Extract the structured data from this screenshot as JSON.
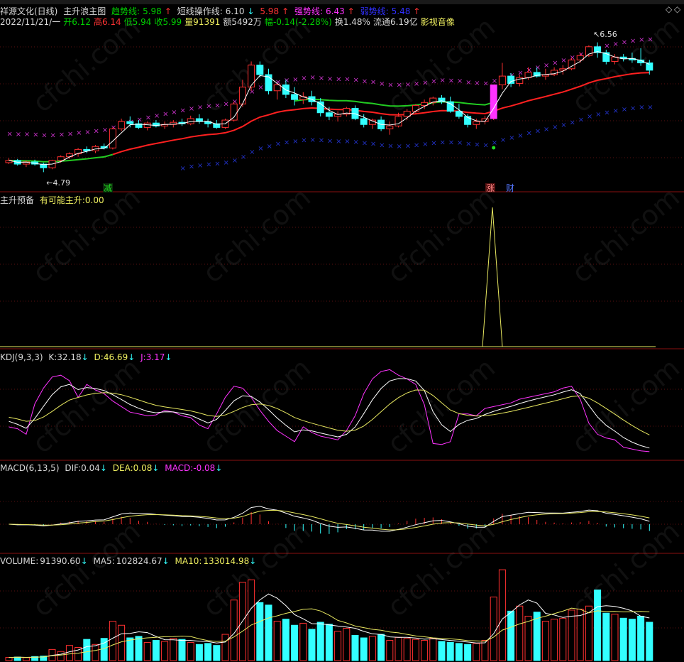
{
  "header": {
    "stock_name": "祥源文化(日线)",
    "indicator_name": "主升浪主图",
    "trend_label": "趋势线:",
    "trend_value": "5.98",
    "short_label": "短线操作线:",
    "short_value": "6.10",
    "mid_value": "5.98",
    "strong_label": "强势线:",
    "strong_value": "6.43",
    "weak_label": "弱势线:",
    "weak_value": "5.48",
    "date": "2022/11/21/一",
    "open_label": "开",
    "open": "6.12",
    "high_label": "高",
    "high": "6.14",
    "low_label": "低",
    "low": "5.94",
    "close_label": "收",
    "close": "5.99",
    "vol_label": "量",
    "vol": "91391",
    "amount_label": "额",
    "amount": "5492万",
    "chg_label": "幅",
    "chg": "-0.14(-2.28%)",
    "turnover_label": "换",
    "turnover": "1.48%",
    "float_label": "流通",
    "float": "6.19亿",
    "sector": "影视音像"
  },
  "panels": {
    "zsyb": {
      "title": "主升预备",
      "label": "有可能主升:",
      "value": "0.00"
    },
    "kdj": {
      "title": "KDJ(9,3,3)",
      "k_label": "K:",
      "k": "32.18",
      "d_label": "D:",
      "d": "46.69",
      "j_label": "J:",
      "j": "3.17"
    },
    "macd": {
      "title": "MACD(6,13,5)",
      "dif_label": "DIF:",
      "dif": "0.04",
      "dea_label": "DEA:",
      "dea": "0.08",
      "macd_label": "MACD:",
      "macd": "-0.08"
    },
    "vol": {
      "title": "VOLUME:",
      "volume": "91390.60",
      "ma5_label": "MA5:",
      "ma5": "102824.67",
      "ma10_label": "MA10:",
      "ma10": "133014.98"
    }
  },
  "annotations": {
    "low_mark": "4.79",
    "high_mark": "6.56",
    "jian": "减",
    "zhang": "涨",
    "cai": "财"
  },
  "watermark": "cfchi.com",
  "arrow_down": "↓",
  "arrow_up": "↑",
  "colors": {
    "up": "#ff3030",
    "down": "#33ffff",
    "trend": "#ff2020",
    "short": "#ffffff",
    "mid_green": "#22cc22",
    "strong": "#cc33cc",
    "weak": "#2233cc",
    "signal": "#ff33ff",
    "yellow": "#e8e860"
  },
  "chart_data": {
    "type": "candlestick",
    "ylim": [
      4.6,
      6.75
    ],
    "candles": [
      [
        4.92,
        4.98,
        4.9,
        4.95
      ],
      [
        4.95,
        4.97,
        4.88,
        4.9
      ],
      [
        4.9,
        4.95,
        4.86,
        4.93
      ],
      [
        4.93,
        4.96,
        4.88,
        4.9
      ],
      [
        4.9,
        4.92,
        4.79,
        4.85
      ],
      [
        4.85,
        4.96,
        4.83,
        4.95
      ],
      [
        4.95,
        5.02,
        4.92,
        5.0
      ],
      [
        5.0,
        5.06,
        4.97,
        5.04
      ],
      [
        5.04,
        5.12,
        5.0,
        5.1
      ],
      [
        5.1,
        5.14,
        5.05,
        5.08
      ],
      [
        5.08,
        5.16,
        5.05,
        5.14
      ],
      [
        5.14,
        5.18,
        5.1,
        5.12
      ],
      [
        5.12,
        5.4,
        5.1,
        5.38
      ],
      [
        5.38,
        5.52,
        5.35,
        5.48
      ],
      [
        5.48,
        5.55,
        5.4,
        5.45
      ],
      [
        5.45,
        5.5,
        5.38,
        5.4
      ],
      [
        5.4,
        5.48,
        5.36,
        5.46
      ],
      [
        5.46,
        5.5,
        5.4,
        5.42
      ],
      [
        5.42,
        5.48,
        5.38,
        5.44
      ],
      [
        5.44,
        5.5,
        5.4,
        5.47
      ],
      [
        5.47,
        5.52,
        5.42,
        5.45
      ],
      [
        5.45,
        5.56,
        5.43,
        5.52
      ],
      [
        5.52,
        5.58,
        5.45,
        5.48
      ],
      [
        5.48,
        5.52,
        5.4,
        5.45
      ],
      [
        5.45,
        5.5,
        5.38,
        5.4
      ],
      [
        5.4,
        5.52,
        5.38,
        5.5
      ],
      [
        5.5,
        5.75,
        5.48,
        5.72
      ],
      [
        5.72,
        6.05,
        5.68,
        5.95
      ],
      [
        5.95,
        6.3,
        5.9,
        6.25
      ],
      [
        6.25,
        6.3,
        6.08,
        6.12
      ],
      [
        6.12,
        6.2,
        5.85,
        5.9
      ],
      [
        5.9,
        6.0,
        5.78,
        5.98
      ],
      [
        5.98,
        6.05,
        5.8,
        5.85
      ],
      [
        5.85,
        5.95,
        5.7,
        5.78
      ],
      [
        5.78,
        5.88,
        5.72,
        5.82
      ],
      [
        5.82,
        5.9,
        5.7,
        5.75
      ],
      [
        5.75,
        5.8,
        5.55,
        5.6
      ],
      [
        5.6,
        5.68,
        5.5,
        5.55
      ],
      [
        5.55,
        5.62,
        5.48,
        5.58
      ],
      [
        5.58,
        5.68,
        5.55,
        5.66
      ],
      [
        5.66,
        5.7,
        5.5,
        5.52
      ],
      [
        5.52,
        5.58,
        5.4,
        5.44
      ],
      [
        5.44,
        5.52,
        5.38,
        5.5
      ],
      [
        5.5,
        5.55,
        5.35,
        5.38
      ],
      [
        5.38,
        5.48,
        5.3,
        5.42
      ],
      [
        5.42,
        5.6,
        5.4,
        5.55
      ],
      [
        5.55,
        5.65,
        5.5,
        5.62
      ],
      [
        5.62,
        5.72,
        5.58,
        5.7
      ],
      [
        5.7,
        5.78,
        5.65,
        5.74
      ],
      [
        5.74,
        5.82,
        5.7,
        5.8
      ],
      [
        5.8,
        5.84,
        5.72,
        5.75
      ],
      [
        5.75,
        5.82,
        5.6,
        5.62
      ],
      [
        5.62,
        5.72,
        5.52,
        5.55
      ],
      [
        5.55,
        5.58,
        5.4,
        5.44
      ],
      [
        5.44,
        5.52,
        5.38,
        5.48
      ],
      [
        5.48,
        5.56,
        5.44,
        5.52
      ],
      [
        5.52,
        5.98,
        5.5,
        5.98
      ],
      [
        5.98,
        6.28,
        5.92,
        6.1
      ],
      [
        6.1,
        6.14,
        5.95,
        6.0
      ],
      [
        6.0,
        6.12,
        5.96,
        6.08
      ],
      [
        6.08,
        6.22,
        6.05,
        6.15
      ],
      [
        6.15,
        6.22,
        6.08,
        6.1
      ],
      [
        6.1,
        6.2,
        6.05,
        6.12
      ],
      [
        6.12,
        6.22,
        6.1,
        6.18
      ],
      [
        6.18,
        6.25,
        6.12,
        6.2
      ],
      [
        6.2,
        6.35,
        6.18,
        6.32
      ],
      [
        6.32,
        6.42,
        6.28,
        6.38
      ],
      [
        6.38,
        6.52,
        6.36,
        6.5
      ],
      [
        6.5,
        6.56,
        6.35,
        6.42
      ],
      [
        6.42,
        6.46,
        6.26,
        6.3
      ],
      [
        6.3,
        6.4,
        6.26,
        6.36
      ],
      [
        6.36,
        6.4,
        6.3,
        6.34
      ],
      [
        6.34,
        6.42,
        6.28,
        6.32
      ],
      [
        6.32,
        6.48,
        6.24,
        6.28
      ],
      [
        6.28,
        6.32,
        6.12,
        6.18
      ]
    ],
    "volume_ylim": [
      0,
      190000
    ],
    "volume": [
      6200,
      7000,
      5800,
      8000,
      9000,
      22000,
      18000,
      30000,
      26000,
      42000,
      32000,
      44000,
      78000,
      70000,
      45000,
      48000,
      36000,
      40000,
      38000,
      44000,
      42000,
      36000,
      32000,
      34000,
      30000,
      52000,
      120000,
      155000,
      160000,
      115000,
      110000,
      78000,
      82000,
      70000,
      74000,
      62000,
      76000,
      72000,
      58000,
      64000,
      50000,
      45000,
      48000,
      52000,
      40000,
      46000,
      44000,
      42000,
      40000,
      44000,
      38000,
      36000,
      34000,
      32000,
      34000,
      40000,
      126000,
      180000,
      98000,
      108000,
      88000,
      96000,
      78000,
      82000,
      84000,
      100000,
      102000,
      108000,
      140000,
      94000,
      92000,
      84000,
      82000,
      88000,
      76000
    ]
  }
}
